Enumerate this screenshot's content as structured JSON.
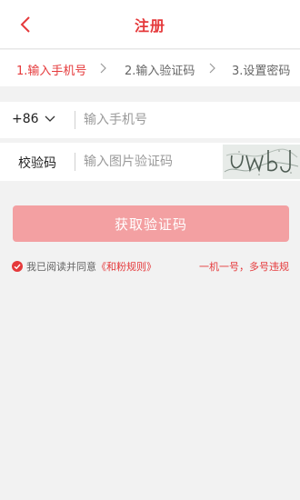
{
  "header": {
    "title": "注册"
  },
  "steps": [
    {
      "label": "1.输入手机号"
    },
    {
      "label": "2.输入验证码"
    },
    {
      "label": "3.设置密码"
    }
  ],
  "phone": {
    "country_code": "+86",
    "placeholder": "输入手机号",
    "value": ""
  },
  "captcha": {
    "label": "校验码",
    "placeholder": "输入图片验证码",
    "value": "",
    "image_text": "uwbJ"
  },
  "submit": {
    "label": "获取验证码"
  },
  "agreement": {
    "prefix": "我已阅读并同意",
    "link": "《和粉规则》",
    "checked": true
  },
  "notice": {
    "text": "一机一号，多号违规"
  },
  "colors": {
    "accent": "#e5393b",
    "button": "#f3a0a2",
    "background": "#f2f2f2"
  }
}
